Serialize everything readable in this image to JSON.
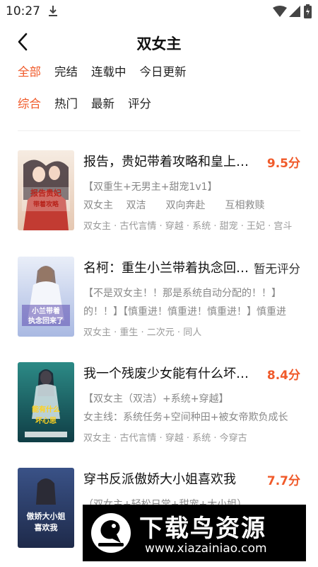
{
  "status_bar": {
    "time": "10:27"
  },
  "header": {
    "title": "双女主"
  },
  "filters": {
    "status": [
      {
        "label": "全部",
        "active": true
      },
      {
        "label": "完结",
        "active": false
      },
      {
        "label": "连载中",
        "active": false
      },
      {
        "label": "今日更新",
        "active": false
      }
    ],
    "sort": [
      {
        "label": "综合",
        "active": true
      },
      {
        "label": "热门",
        "active": false
      },
      {
        "label": "最新",
        "active": false
      },
      {
        "label": "评分",
        "active": false
      }
    ]
  },
  "books": [
    {
      "title": "报告，贵妃带着攻略和皇上私奔了",
      "score": "9.5分",
      "desc1": "【双重生+无男主+甜宠1v1】",
      "desc2": "双女主　 双洁　　双向奔赴　　互相救赎",
      "tags": "双女主 · 古代言情 · 穿越 · 系统 · 甜宠 · 王妃 · 宫斗"
    },
    {
      "title": "名柯：重生小兰带着执念回来了",
      "score": "暂无评分",
      "desc1": "【不是双女主！！那是系统自动分配的！！】",
      "desc2": "的！！】【慎重进！慎重进！慎重进！】慎重进",
      "tags": "双女主 · 重生 · 二次元 · 同人"
    },
    {
      "title": "我一个残废少女能有什么坏心思",
      "score": "8.4分",
      "desc1": "【双女主（双洁）+系统+穿越】",
      "desc2": "女主线：系统任务+空间种田+被女帝欺负成长",
      "tags": "双女主 · 古代言情 · 穿越 · 系统 · 今穿古"
    },
    {
      "title": "穿书反派傲娇大小姐喜欢我",
      "score": "7.7分",
      "desc1": "（双女主+轻松日常+甜宠+大小姐）",
      "desc2": "",
      "tags": ""
    }
  ],
  "covers": [
    {
      "text": "报告贵妃带着攻略和皇上私奔了",
      "bg": "#f3e6d8",
      "accent": "#b8241c"
    },
    {
      "text": "小兰带着执念回来了",
      "bg": "#cfd9ef",
      "accent": "#ffffff"
    },
    {
      "text": "能有什么坏心思",
      "bg": "#1f6f73",
      "accent": "#ffd21f"
    },
    {
      "text": "傲娇大小姐喜欢我",
      "bg": "#2c3e6a",
      "accent": "#ffffff"
    }
  ],
  "watermark": {
    "cn": "下载鸟资源",
    "url": "www.xiazainiao.com"
  },
  "colors": {
    "accent": "#f05a2a",
    "text": "#222222",
    "muted": "#888888"
  }
}
